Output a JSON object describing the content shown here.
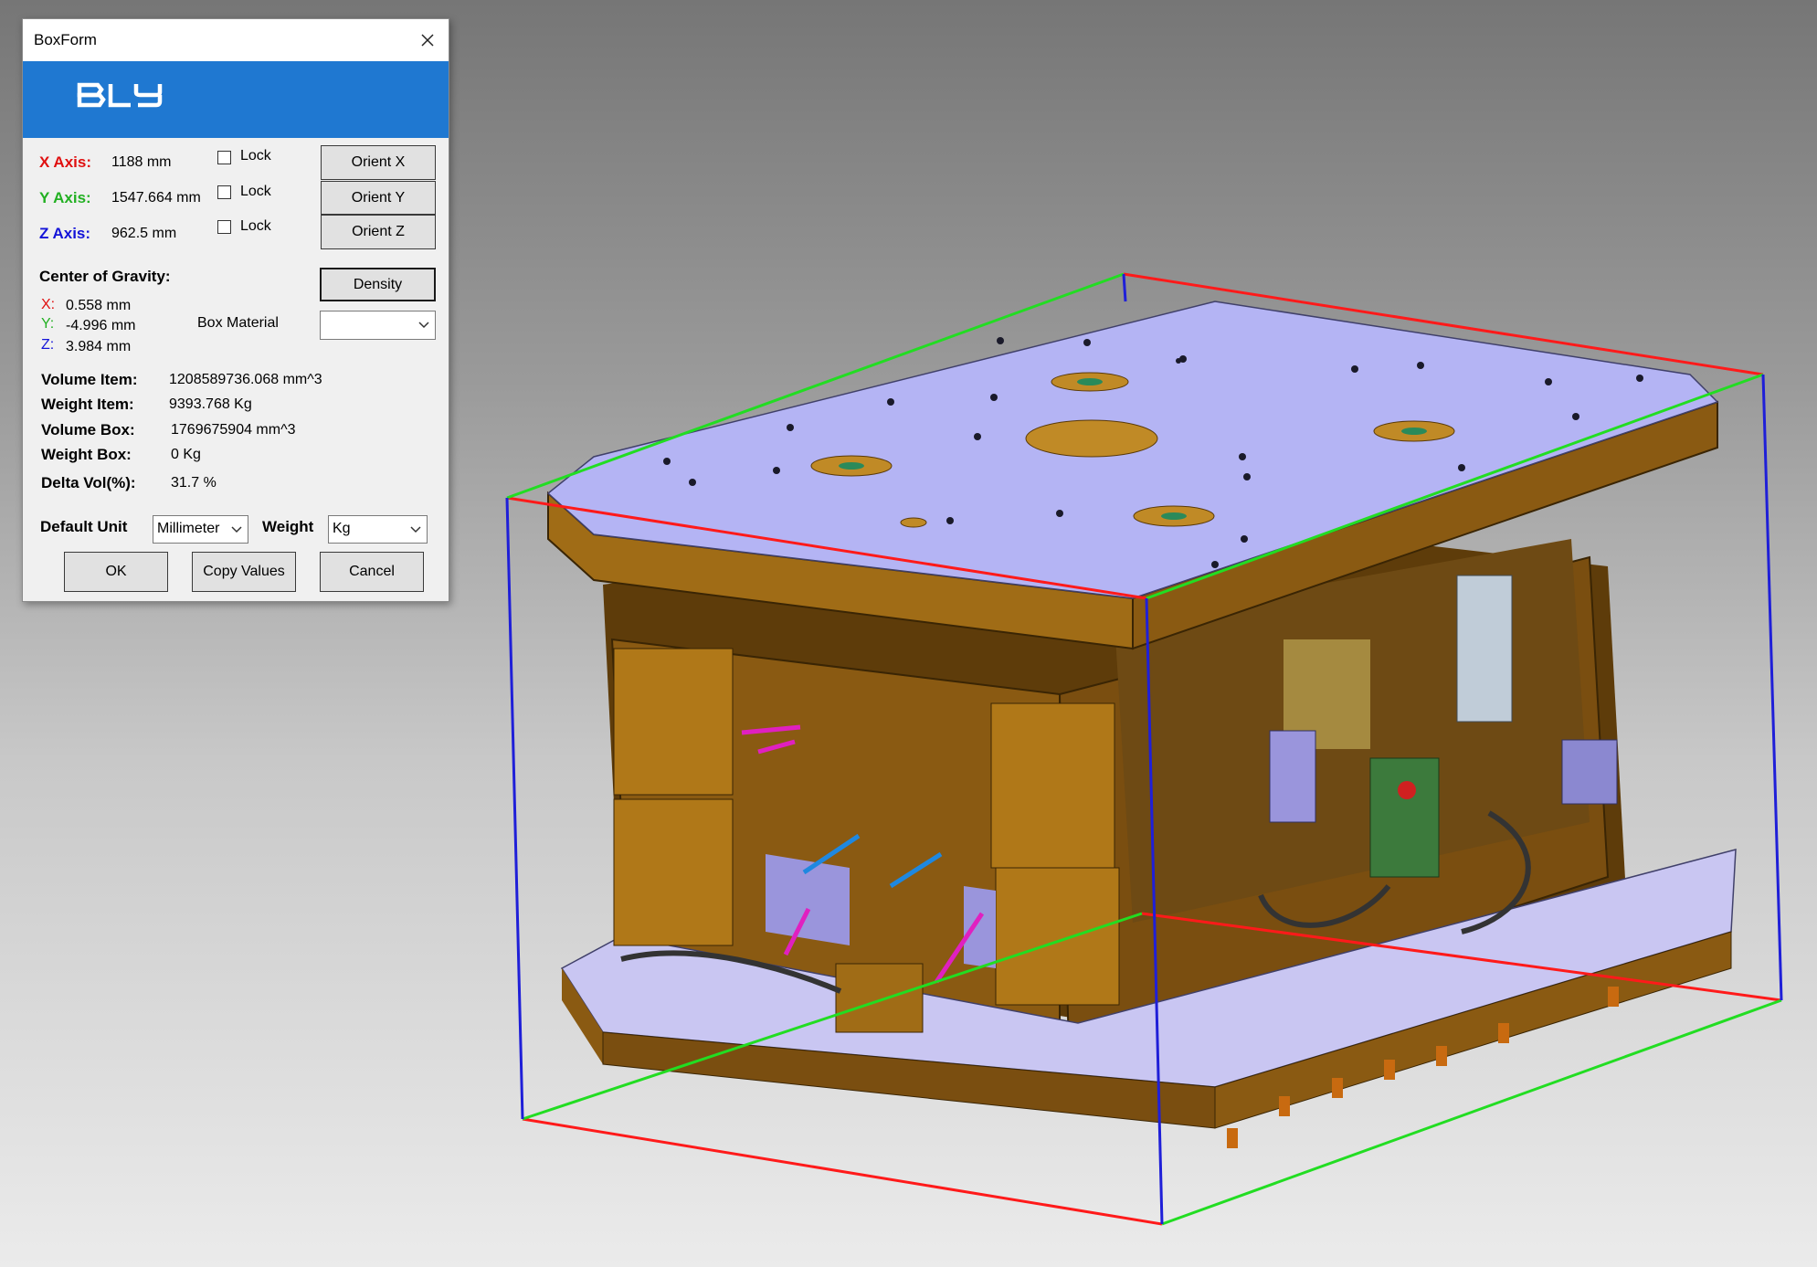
{
  "window": {
    "title": "BoxForm",
    "logo_text": "BLY"
  },
  "axes": [
    {
      "label": "X Axis:",
      "value": "1188 mm",
      "lock_label": "Lock",
      "locked": false,
      "orient_label": "Orient X",
      "color": "#e01010"
    },
    {
      "label": "Y Axis:",
      "value": "1547.664 mm",
      "lock_label": "Lock",
      "locked": false,
      "orient_label": "Orient Y",
      "color": "#22b022"
    },
    {
      "label": "Z Axis:",
      "value": "962.5 mm",
      "lock_label": "Lock",
      "locked": false,
      "orient_label": "Orient Z",
      "color": "#1414d8"
    }
  ],
  "cog": {
    "title": "Center of Gravity:",
    "x_label": "X:",
    "x_value": "0.558 mm",
    "y_label": "Y:",
    "y_value": "-4.996 mm",
    "z_label": "Z:",
    "z_value": "3.984 mm"
  },
  "density_label": "Density",
  "box_material": {
    "label": "Box Material",
    "value": ""
  },
  "stats": [
    {
      "label": "Volume Item:",
      "value": "1208589736.068 mm^3"
    },
    {
      "label": "Weight Item:",
      "value": "9393.768 Kg"
    },
    {
      "label": "Volume Box:",
      "value": "1769675904 mm^3"
    },
    {
      "label": "Weight Box:",
      "value": "0 Kg"
    },
    {
      "label": "Delta Vol(%):",
      "value": "31.7 %"
    }
  ],
  "default_unit": {
    "label": "Default Unit",
    "value": "Millimeter"
  },
  "weight_unit": {
    "label": "Weight",
    "value": "Kg"
  },
  "buttons": {
    "ok": "OK",
    "copy": "Copy Values",
    "cancel": "Cancel"
  },
  "colors": {
    "banner": "#1f78d1",
    "bbox_x": "#ff1a1a",
    "bbox_y": "#22dd22",
    "bbox_z": "#1f1fd8",
    "plate_top": "#b4b4f4",
    "mold_body": "#8a5a12"
  }
}
